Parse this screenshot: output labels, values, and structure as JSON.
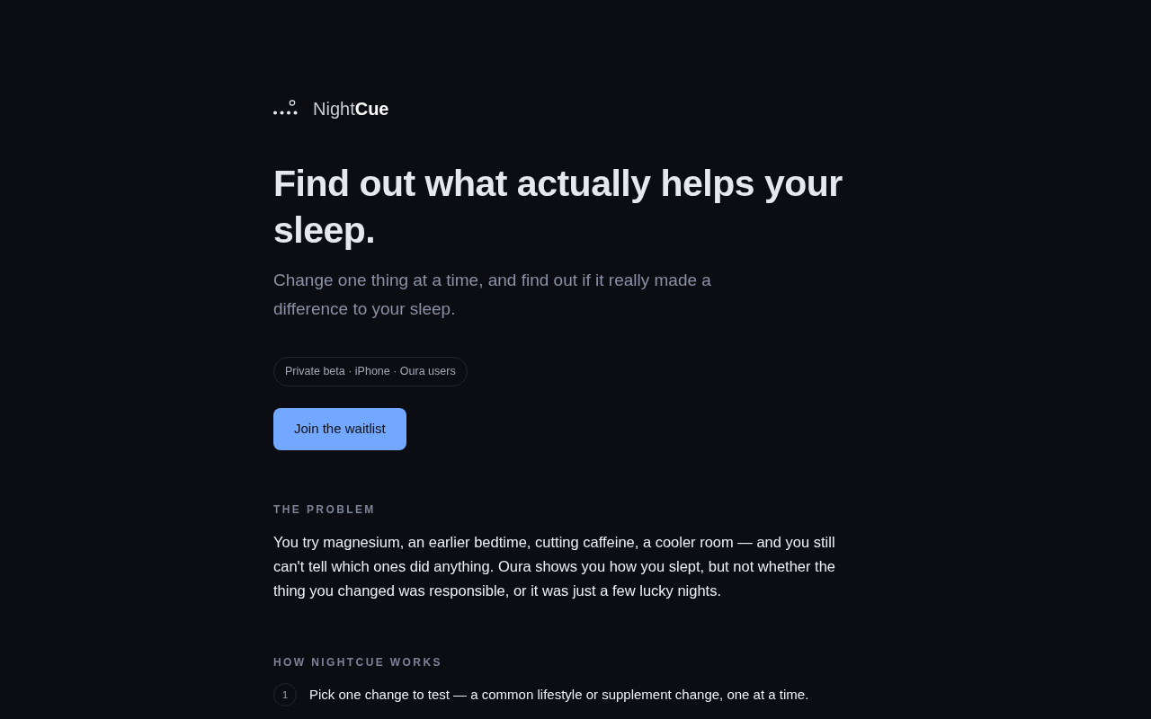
{
  "brand": {
    "name": "Night**Cue**"
  },
  "hero": {
    "title": "Find out what actually helps your sleep.",
    "subtitle": "Change one thing at a time, and find out if it really made a difference to your sleep.",
    "badge": "Private beta · iPhone · Oura users",
    "cta": "Join the waitlist"
  },
  "sections": [
    {
      "kind": "paragraph",
      "heading": "THE PROBLEM",
      "body": "You try magnesium, an earlier bedtime, cutting caffeine, a cooler room — and you still can't tell which ones did anything. Oura shows you how you slept, but not whether the thing you changed was responsible, or it was just a few lucky nights."
    },
    {
      "kind": "steps",
      "heading": "HOW NIGHTCUE WORKS",
      "steps": [
        {
          "number": "1",
          "text": "Pick one change to test — a common lifestyle or supplement change, one at a time."
        }
      ]
    }
  ]
}
